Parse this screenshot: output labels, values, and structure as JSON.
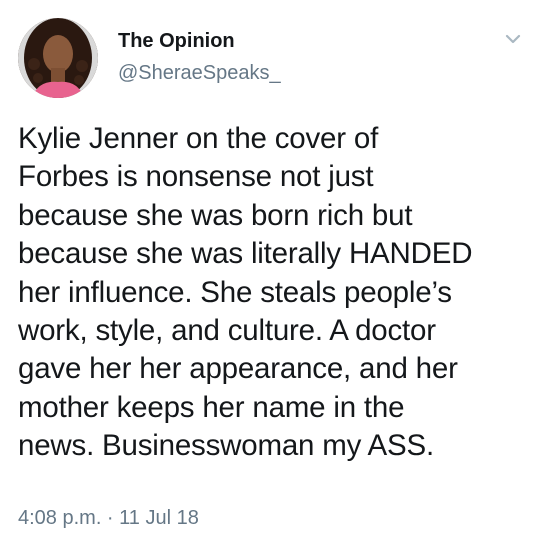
{
  "tweet": {
    "display_name": "The Opinion",
    "handle": "@SheraeSpeaks_",
    "text_lines": [
      "Kylie Jenner on the cover of",
      "Forbes is nonsense not just",
      "because she was born rich but",
      "because she was literally HANDED",
      "her influence. She steals people’s",
      "work, style, and culture. A doctor",
      "gave her her appearance, and her",
      "mother keeps her name in the",
      "news. Businesswoman my ASS."
    ],
    "timestamp": "4:08 p.m. · 11 Jul 18"
  },
  "icons": {
    "avatar": "profile-photo",
    "menu": "chevron-down-icon"
  },
  "colors": {
    "text": "#14171a",
    "secondary": "#657786",
    "chevron": "#aab8c2",
    "background": "#ffffff"
  }
}
